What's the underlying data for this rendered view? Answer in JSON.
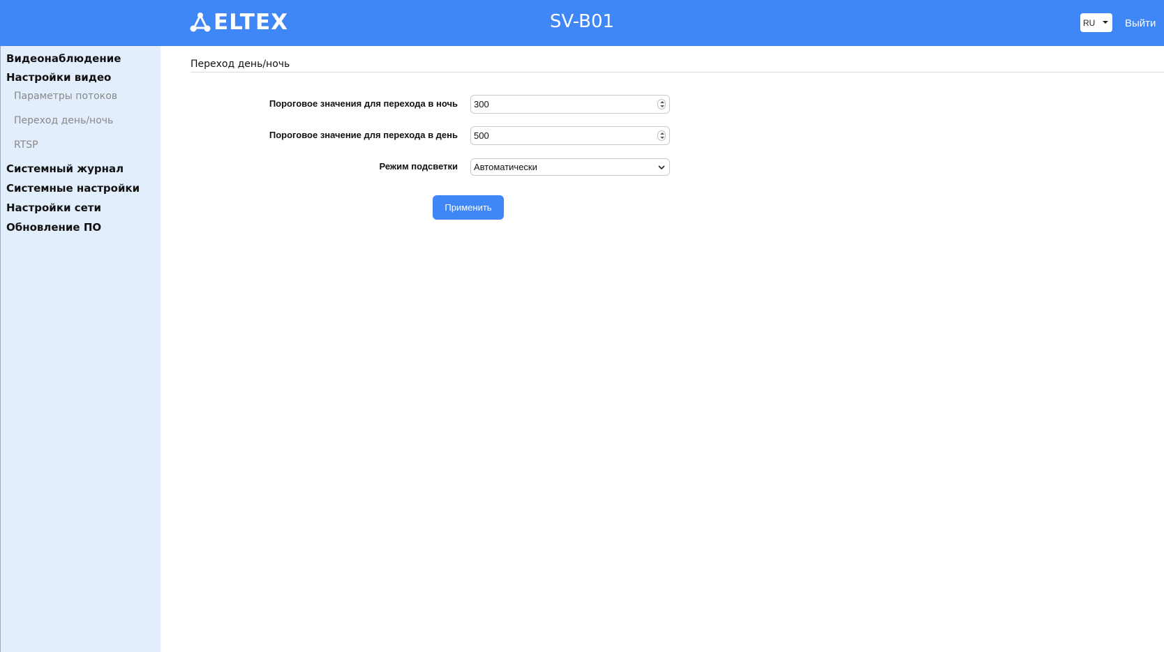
{
  "header": {
    "logo_text": "ELTEX",
    "device_title": "SV-B01",
    "language": "RU",
    "logout_label": "Выйти",
    "background_color": "#3f86f7"
  },
  "sidebar": {
    "items": [
      {
        "label": "Видеонаблюдение",
        "level": 1
      },
      {
        "label": "Настройки видео",
        "level": 1
      },
      {
        "label": "Параметры потоков",
        "level": 2
      },
      {
        "label": "Переход день/ночь",
        "level": 2
      },
      {
        "label": "RTSP",
        "level": 2
      },
      {
        "label": "Системный журнал",
        "level": 1
      },
      {
        "label": "Системные настройки",
        "level": 1
      },
      {
        "label": "Настройки сети",
        "level": 1
      },
      {
        "label": "Обновление ПО",
        "level": 1
      }
    ],
    "background_color": "#e3eefc"
  },
  "main": {
    "page_title": "Переход день/ночь",
    "fields": [
      {
        "label": "Пороговое значения для перехода в ночь",
        "value": "300",
        "type": "number"
      },
      {
        "label": "Пороговое значение для перехода в день",
        "value": "500",
        "type": "number"
      },
      {
        "label": "Режим подсветки",
        "value": "Автоматически",
        "type": "select"
      }
    ],
    "apply_label": "Применить",
    "accent_color": "#3f86f7"
  }
}
